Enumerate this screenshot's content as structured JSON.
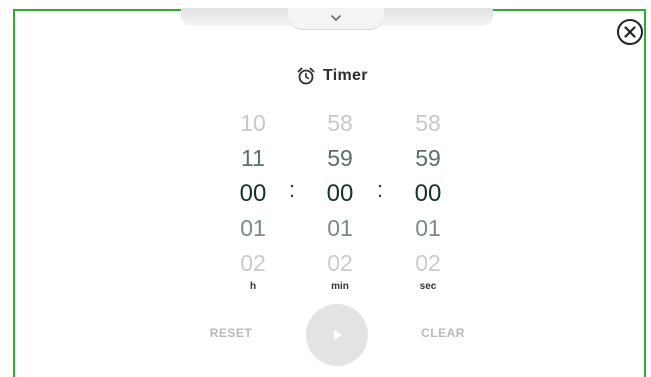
{
  "title": "Timer",
  "icons": {
    "title_icon": "alarm-clock-icon",
    "close": "close-icon",
    "handle": "chevron-down-icon",
    "play": "play-icon"
  },
  "picker": {
    "hours": [
      "10",
      "11",
      "00",
      "01",
      "02"
    ],
    "minutes": [
      "58",
      "59",
      "00",
      "01",
      "02"
    ],
    "seconds": [
      "58",
      "59",
      "00",
      "01",
      "02"
    ],
    "separator": ":",
    "units": {
      "hours": "h",
      "minutes": "min",
      "seconds": "sec"
    }
  },
  "controls": {
    "reset_label": "RESET",
    "clear_label": "CLEAR"
  },
  "colors": {
    "frame_border": "#2faa3c",
    "digit_selected": "#123528",
    "disabled_text": "#b9b9b9"
  }
}
